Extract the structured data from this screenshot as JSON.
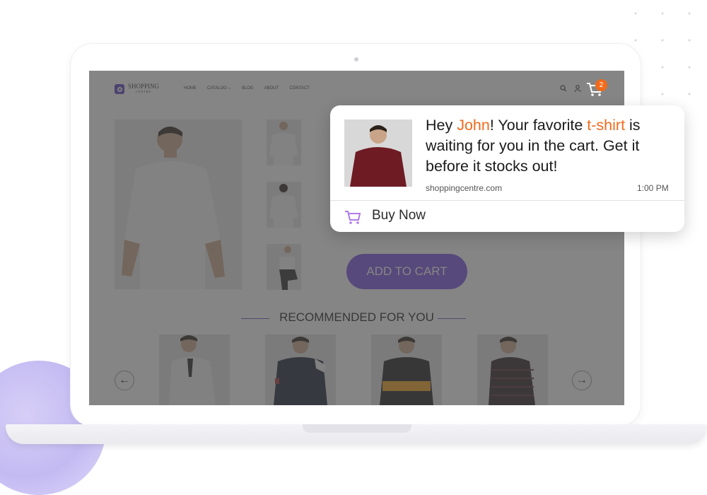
{
  "site": {
    "logo_text": "SHOPPING",
    "logo_sub": "CENTRE",
    "menu": [
      "HOME",
      "CATALOG",
      "BLOG",
      "ABOUT",
      "CONTACT"
    ],
    "catalog_chevron": "⌵",
    "cart_count": "2"
  },
  "product": {
    "add_to_cart": "ADD TO CART"
  },
  "recommended": {
    "heading": "RECOMMENDED FOR YOU",
    "prev_arrow": "←",
    "next_arrow": "→"
  },
  "notification": {
    "msg_1": "Hey ",
    "name": "John",
    "msg_2": "! Your favorite ",
    "item": "t-shirt",
    "msg_3": " is waiting for you in the cart. Get it before it stocks out!",
    "site": "shoppingcentre.com",
    "time": "1:00 PM",
    "action": "Buy Now"
  },
  "colors": {
    "accent": "#f26a1b",
    "brand_purple": "#7a4fe0",
    "overlay": "#464646"
  },
  "icons": [
    "search-icon",
    "user-icon",
    "cart-icon",
    "arrow-left-icon",
    "arrow-right-icon"
  ]
}
